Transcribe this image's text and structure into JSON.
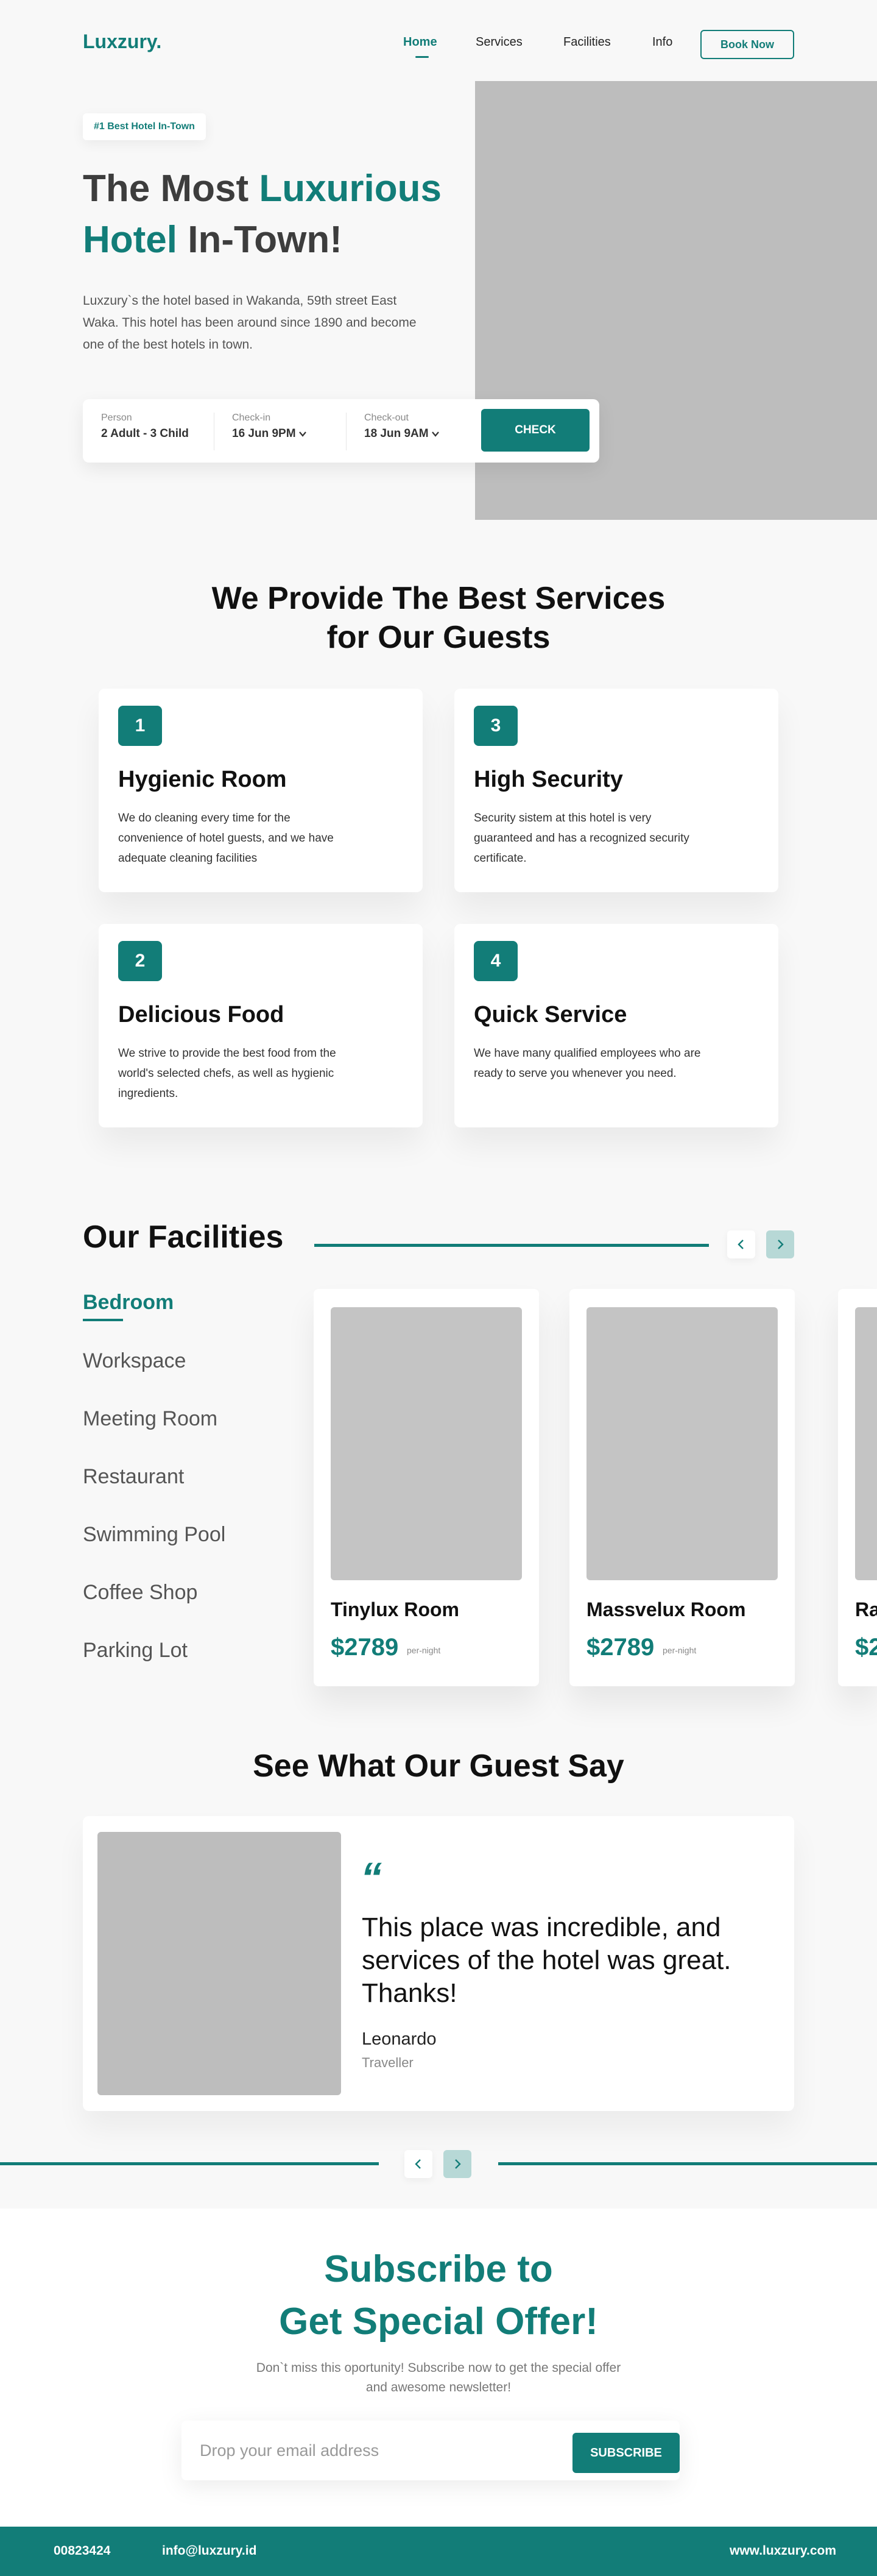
{
  "brand": {
    "logo": "Luxzury."
  },
  "nav": {
    "items": [
      {
        "label": "Home",
        "active": true
      },
      {
        "label": "Services",
        "active": false
      },
      {
        "label": "Facilities",
        "active": false
      },
      {
        "label": "Info",
        "active": false
      }
    ],
    "cta": "Book Now"
  },
  "hero": {
    "badge": "#1  Best Hotel In-Town",
    "title_part1": "The Most ",
    "title_accent1": "Luxurious",
    "title_accent2": "Hotel",
    "title_part2": " In-Town!",
    "description": "Luxzury`s the hotel based in Wakanda, 59th street East Waka. This hotel has been around since 1890 and become one of the best hotels in town."
  },
  "booking": {
    "person_label": "Person",
    "person_value": "2 Adult - 3 Child",
    "checkin_label": "Check-in",
    "checkin_value": "16 Jun 9PM",
    "checkout_label": "Check-out",
    "checkout_value": "18 Jun 9AM",
    "check_button": "CHECK"
  },
  "services": {
    "title_line1": "We Provide The Best Services",
    "title_line2": "for Our Guests",
    "cards": [
      {
        "num": "1",
        "title": "Hygienic Room",
        "desc": "We do cleaning every time for the convenience of hotel guests, and we have adequate cleaning facilities"
      },
      {
        "num": "3",
        "title": "High Security",
        "desc": "Security sistem at this hotel is very guaranteed and has a recognized security certificate."
      },
      {
        "num": "2",
        "title": "Delicious Food",
        "desc": "We strive to provide the best food from the world's selected chefs, as well as hygienic ingredients."
      },
      {
        "num": "4",
        "title": "Quick Service",
        "desc": "We have many qualified employees who are ready to serve you whenever you need."
      }
    ]
  },
  "facilities": {
    "title": "Our Facilities",
    "menu": [
      "Bedroom",
      "Workspace",
      "Meeting Room",
      "Restaurant",
      "Swimming Pool",
      "Coffee Shop",
      "Parking Lot"
    ],
    "rooms": [
      {
        "name": "Tinylux Room",
        "price": "$2789",
        "per": "per-night"
      },
      {
        "name": "Massvelux Room",
        "price": "$2789",
        "per": "per-night"
      },
      {
        "name": "Ra",
        "price": "$2",
        "per": ""
      }
    ]
  },
  "testimonial": {
    "title": "See What Our Guest Say",
    "quote_mark": "“",
    "text": "This place was incredible, and services of the hotel was great. Thanks!",
    "name": "Leonardo",
    "role": "Traveller"
  },
  "subscribe": {
    "title_line1": "Subscribe to",
    "title_line2": "Get Special Offer!",
    "desc_line1": "Don`t miss this oportunity! Subscribe now to get the special offer",
    "desc_line2": "and awesome newsletter!",
    "placeholder": "Drop your email address",
    "button": "SUBSCRIBE"
  },
  "footer": {
    "phone": "00823424",
    "email": "info@luxzury.id",
    "website": "www.luxzury.com"
  },
  "colors": {
    "accent": "#127d78",
    "accent_light": "#b7d8d6",
    "placeholder_image": "#bdbdbd"
  },
  "icons": {
    "prev": "chevron-left-icon",
    "next": "chevron-right-icon",
    "dropdown": "chevron-down-icon"
  }
}
